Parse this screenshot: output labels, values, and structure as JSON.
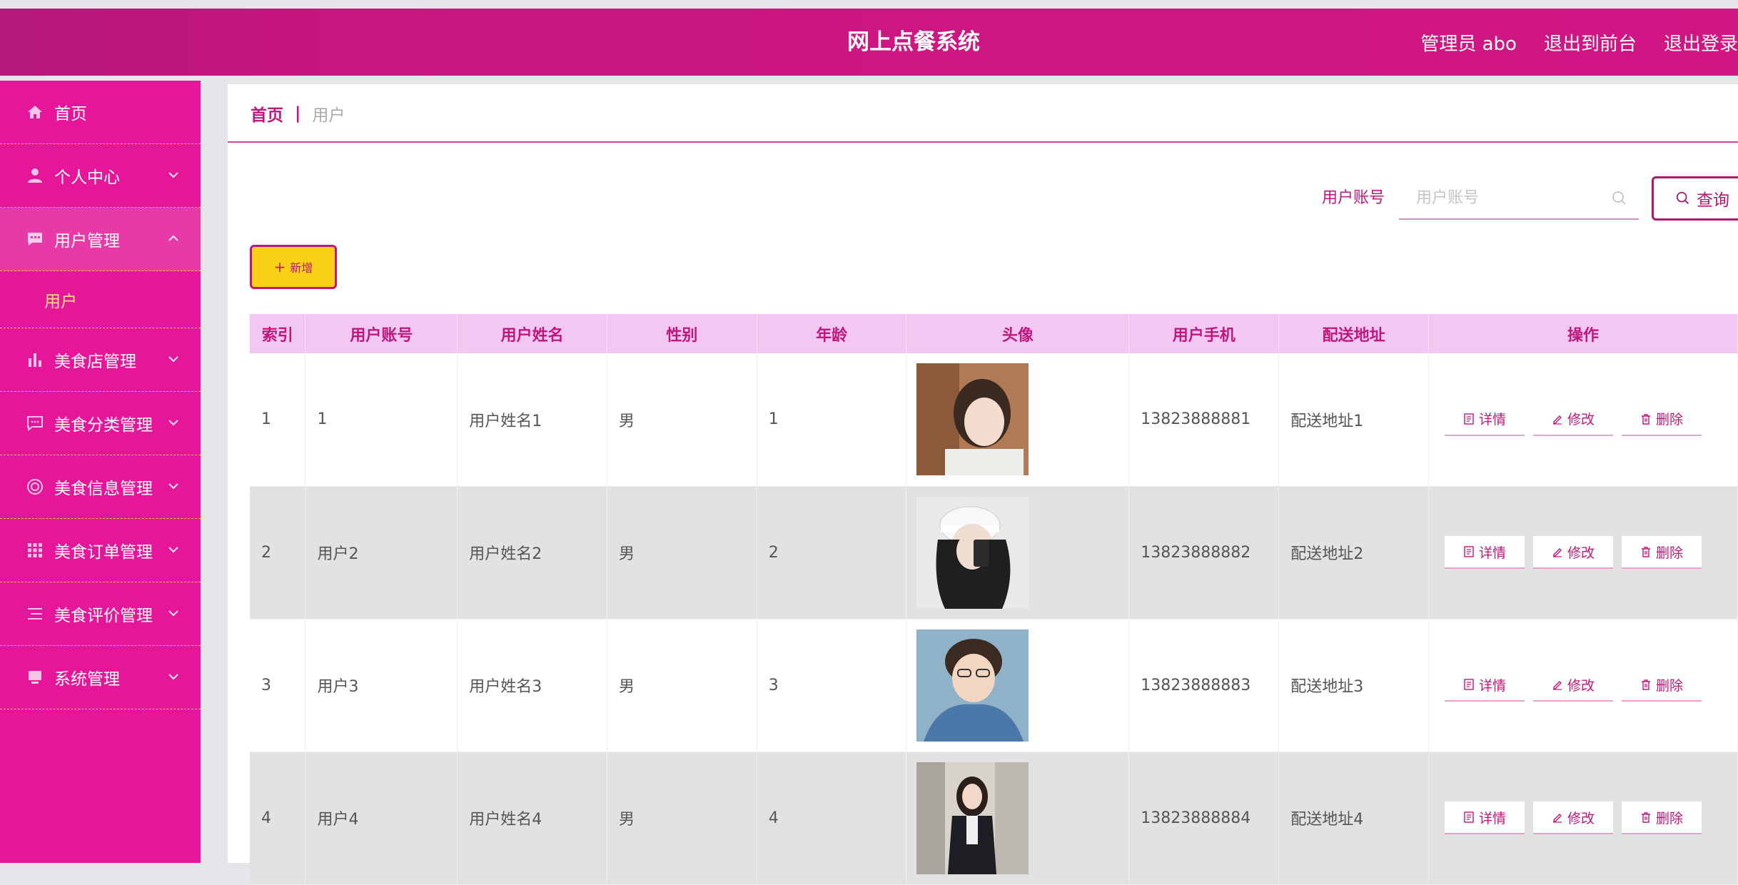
{
  "header": {
    "title": "网上点餐系统",
    "admin_label": "管理员 abo",
    "front_label": "退出到前台",
    "logout_label": "退出登录"
  },
  "sidebar": {
    "items": [
      {
        "label": "首页",
        "icon": "home-icon"
      },
      {
        "label": "个人中心",
        "icon": "user-icon"
      },
      {
        "label": "用户管理",
        "icon": "chat-icon"
      },
      {
        "label": "美食店管理",
        "icon": "bar-chart-icon"
      },
      {
        "label": "美食分类管理",
        "icon": "message-icon"
      },
      {
        "label": "美食信息管理",
        "icon": "lifebuoy-icon"
      },
      {
        "label": "美食订单管理",
        "icon": "grid-icon"
      },
      {
        "label": "美食评价管理",
        "icon": "list-icon"
      },
      {
        "label": "系统管理",
        "icon": "monitor-icon"
      }
    ],
    "submenu": {
      "label": "用户"
    }
  },
  "breadcrumb": {
    "home": "首页",
    "separator": "|",
    "current": "用户"
  },
  "search": {
    "label": "用户账号",
    "placeholder": "用户账号",
    "button": "查询"
  },
  "toolbar": {
    "add_label": "新增"
  },
  "table": {
    "headers": [
      "索引",
      "用户账号",
      "用户姓名",
      "性别",
      "年龄",
      "头像",
      "用户手机",
      "配送地址",
      "操作"
    ],
    "rows": [
      {
        "index": "1",
        "account": "1",
        "name": "用户姓名1",
        "gender": "男",
        "age": "1",
        "phone": "13823888881",
        "address": "配送地址1"
      },
      {
        "index": "2",
        "account": "用户2",
        "name": "用户姓名2",
        "gender": "男",
        "age": "2",
        "phone": "13823888882",
        "address": "配送地址2"
      },
      {
        "index": "3",
        "account": "用户3",
        "name": "用户姓名3",
        "gender": "男",
        "age": "3",
        "phone": "13823888883",
        "address": "配送地址3"
      },
      {
        "index": "4",
        "account": "用户4",
        "name": "用户姓名4",
        "gender": "男",
        "age": "4",
        "phone": "13823888884",
        "address": "配送地址4"
      }
    ],
    "actions": {
      "detail": "详情",
      "edit": "修改",
      "delete": "删除"
    }
  },
  "colors": {
    "primary": "#e5169a",
    "header": "#c8167f",
    "accent": "#c0177c",
    "add_button": "#fad016"
  }
}
